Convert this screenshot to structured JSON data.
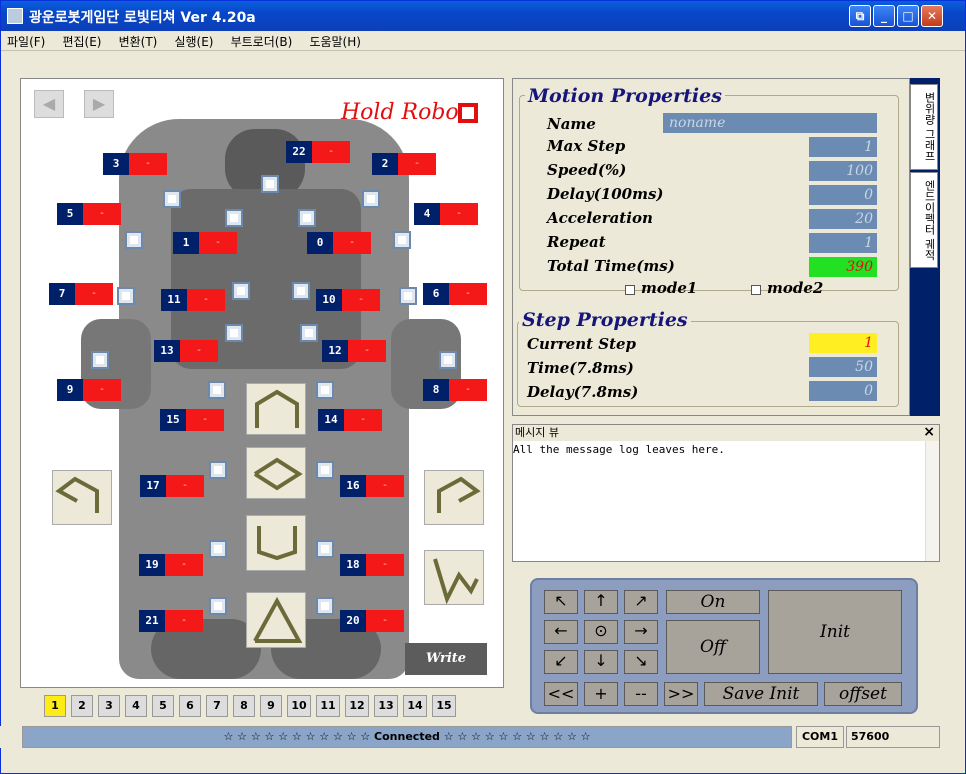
{
  "window": {
    "title": "광운로봇게임단 로빛티쳐 Ver 4.20a"
  },
  "menu": [
    "파일(F)",
    "편집(E)",
    "변환(T)",
    "실행(E)",
    "부트로더(B)",
    "도움말(H)"
  ],
  "robot": {
    "hold_label": "Hold Robot",
    "servos": [
      {
        "id": "3",
        "label": "3"
      },
      {
        "id": "22",
        "label": "22"
      },
      {
        "id": "2",
        "label": "2"
      },
      {
        "id": "5",
        "label": "5"
      },
      {
        "id": "4",
        "label": "4"
      },
      {
        "id": "1",
        "label": "1"
      },
      {
        "id": "0",
        "label": "0"
      },
      {
        "id": "7",
        "label": "7"
      },
      {
        "id": "11",
        "label": "11"
      },
      {
        "id": "10",
        "label": "10"
      },
      {
        "id": "6",
        "label": "6"
      },
      {
        "id": "13",
        "label": "13"
      },
      {
        "id": "12",
        "label": "12"
      },
      {
        "id": "9",
        "label": "9"
      },
      {
        "id": "8",
        "label": "8"
      },
      {
        "id": "15",
        "label": "15"
      },
      {
        "id": "14",
        "label": "14"
      },
      {
        "id": "17",
        "label": "17"
      },
      {
        "id": "16",
        "label": "16"
      },
      {
        "id": "19",
        "label": "19"
      },
      {
        "id": "18",
        "label": "18"
      },
      {
        "id": "21",
        "label": "21"
      },
      {
        "id": "20",
        "label": "20"
      }
    ],
    "servo_value": "-",
    "write_label": "Write"
  },
  "pages": [
    "1",
    "2",
    "3",
    "4",
    "5",
    "6",
    "7",
    "8",
    "9",
    "10",
    "11",
    "12",
    "13",
    "14",
    "15"
  ],
  "motion": {
    "title": "Motion Properties",
    "name_label": "Name",
    "name_value": "noname",
    "max_step_label": "Max Step",
    "max_step_value": "1",
    "speed_label": "Speed(%)",
    "speed_value": "100",
    "delay_label": "Delay(100ms)",
    "delay_value": "0",
    "accel_label": "Acceleration",
    "accel_value": "20",
    "repeat_label": "Repeat",
    "repeat_value": "1",
    "total_label": "Total Time(ms)",
    "total_value": "390",
    "mode1_label": "mode1",
    "mode2_label": "mode2"
  },
  "step": {
    "title": "Step Properties",
    "current_label": "Current Step",
    "current_value": "1",
    "time_label": "Time(7.8ms)",
    "time_value": "50",
    "delay_label": "Delay(7.8ms)",
    "delay_value": "0"
  },
  "tabs": [
    "변위량 그래프",
    "엔드이펙터 궤적"
  ],
  "messages": {
    "title": "메시지 뷰",
    "close": "×",
    "text": "All the message log leaves here."
  },
  "controls": {
    "arrows": [
      "↖",
      "↑",
      "↗",
      "←",
      "⊙",
      "→",
      "↙",
      "↓",
      "↘"
    ],
    "on": "On",
    "off": "Off",
    "init": "Init",
    "prev": "<<",
    "plus": "+",
    "minus": "--",
    "next": ">>",
    "save_init": "Save Init",
    "offset": "offset"
  },
  "status": {
    "main": "☆ ☆ ☆ ☆ ☆ ☆ ☆ ☆ ☆ ☆ ☆  Connected  ☆ ☆ ☆ ☆ ☆ ☆ ☆ ☆ ☆ ☆ ☆",
    "port": "COM1",
    "baud": "57600"
  },
  "colors": {
    "servo_num": "#00206a",
    "servo_val": "#f41818",
    "accent": "#0747c8",
    "total_time_bg": "#22e022",
    "current_step_bg": "#ffee22"
  }
}
